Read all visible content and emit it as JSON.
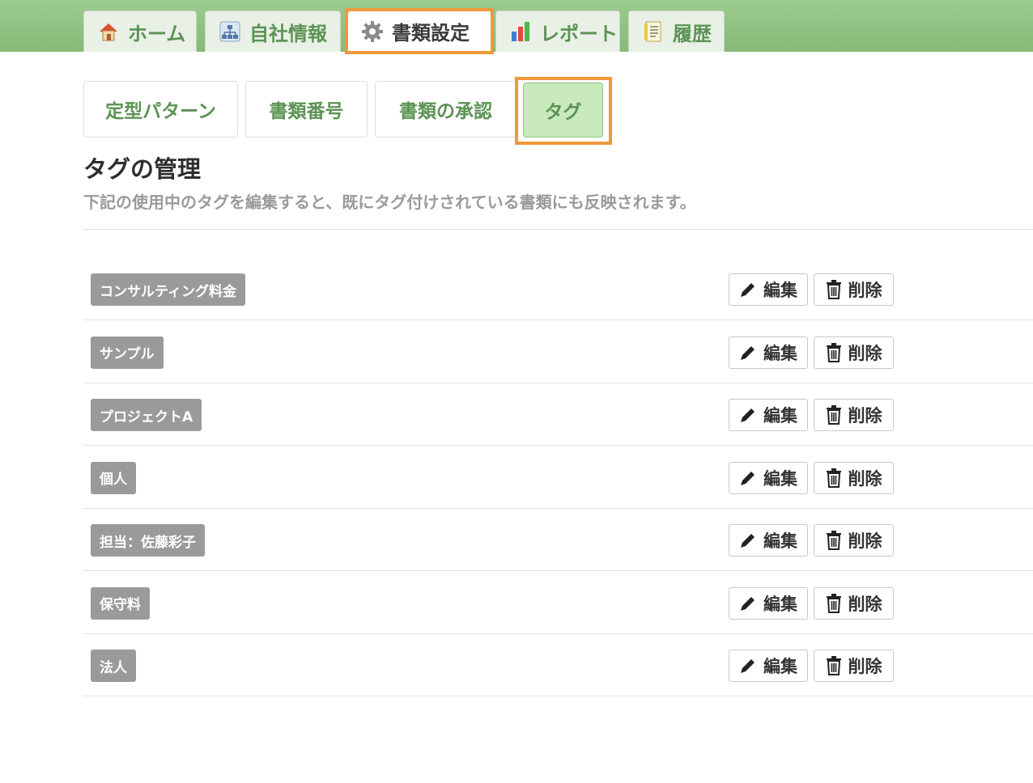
{
  "main_tabs": [
    {
      "label": "ホーム",
      "icon": "home-icon"
    },
    {
      "label": "自社情報",
      "icon": "org-chart-icon"
    },
    {
      "label": "書類設定",
      "icon": "gear-icon",
      "active": true
    },
    {
      "label": "レポート",
      "icon": "bar-chart-icon"
    },
    {
      "label": "履歴",
      "icon": "history-icon"
    }
  ],
  "sub_tabs": [
    {
      "label": "定型パターン"
    },
    {
      "label": "書類番号"
    },
    {
      "label": "書類の承認"
    },
    {
      "label": "タグ",
      "active": true
    }
  ],
  "section": {
    "title": "タグの管理",
    "description": "下記の使用中のタグを編集すると、既にタグ付けされている書類にも反映されます。"
  },
  "tags": [
    {
      "name": "コンサルティング料金",
      "edit_label": "編集",
      "delete_label": "削除"
    },
    {
      "name": "サンプル",
      "edit_label": "編集",
      "delete_label": "削除"
    },
    {
      "name": "プロジェクトA",
      "edit_label": "編集",
      "delete_label": "削除"
    },
    {
      "name": "個人",
      "edit_label": "編集",
      "delete_label": "削除"
    },
    {
      "name": "担当：佐藤彩子",
      "edit_label": "編集",
      "delete_label": "削除"
    },
    {
      "name": "保守料",
      "edit_label": "編集",
      "delete_label": "削除"
    },
    {
      "name": "法人",
      "edit_label": "編集",
      "delete_label": "削除"
    }
  ],
  "colors": {
    "header_green": "#8fbf80",
    "tab_text_green": "#5c9354",
    "highlight_orange": "#f0983a",
    "active_subtab_bg": "#c9eabd",
    "tag_gray": "#9a9a9a"
  }
}
